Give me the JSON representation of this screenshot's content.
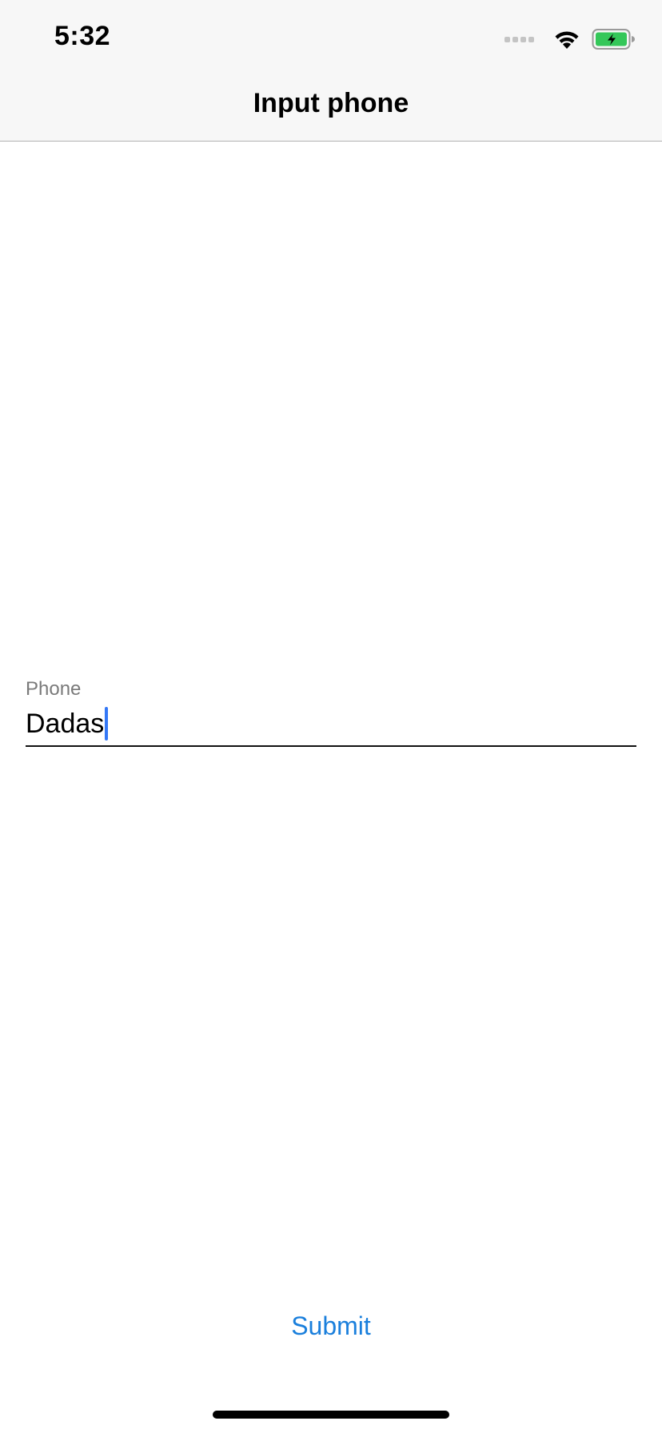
{
  "status_bar": {
    "time": "5:32",
    "icons": [
      "cellular-signal-icon",
      "wifi-icon",
      "battery-charging-icon"
    ],
    "battery_color": "#34c759"
  },
  "nav": {
    "title": "Input phone"
  },
  "form": {
    "phone_label": "Phone",
    "phone_value": "Dadas",
    "caret_color": "#3478f6"
  },
  "actions": {
    "submit_label": "Submit",
    "submit_color": "#1a7fdc"
  }
}
